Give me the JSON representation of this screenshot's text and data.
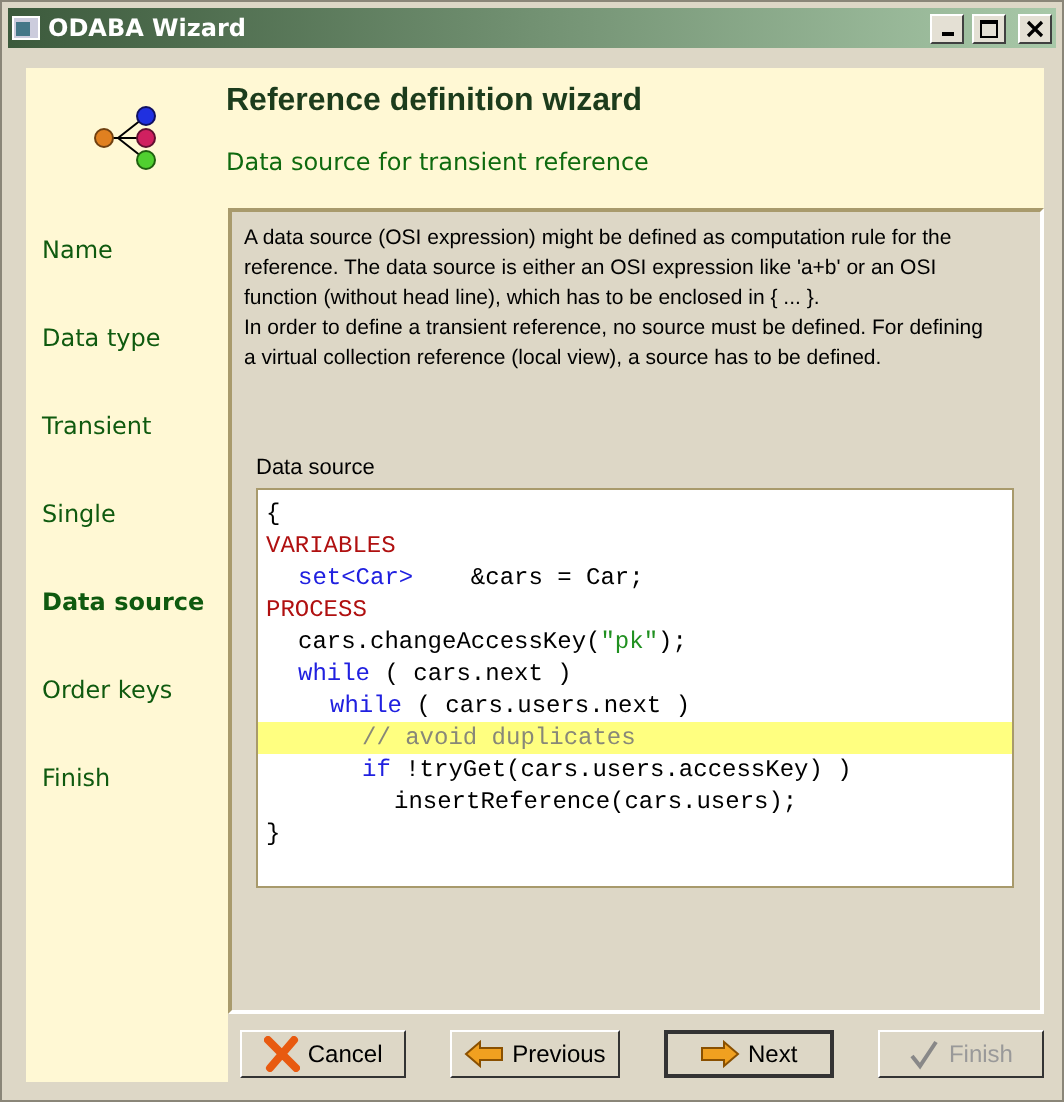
{
  "window": {
    "title": "ODABA Wizard"
  },
  "header": {
    "title": "Reference definition wizard",
    "subtitle": "Data source for transient reference"
  },
  "steps": [
    {
      "label": "Name",
      "selected": false
    },
    {
      "label": "Data type",
      "selected": false
    },
    {
      "label": "Transient",
      "selected": false
    },
    {
      "label": "Single",
      "selected": false
    },
    {
      "label": "Data source",
      "selected": true
    },
    {
      "label": "Order keys",
      "selected": false
    },
    {
      "label": "Finish",
      "selected": false
    }
  ],
  "description": [
    "A data source (OSI expression) might be defined as computation rule for the reference. The data source is either an OSI expression like 'a+b' or an OSI function (without head line), which has to be enclosed in { ... }.",
    "In order to define a transient reference, no source must be defined. For defining a virtual collection reference (local view), a source has to be defined."
  ],
  "editor": {
    "label": "Data source",
    "lines": [
      {
        "highlighted": false,
        "segments": [
          {
            "kind": "plain",
            "text": "{"
          }
        ]
      },
      {
        "highlighted": false,
        "segments": [
          {
            "kind": "keyword",
            "text": "VARIABLES"
          }
        ],
        "children": [
          {
            "highlighted": false,
            "segments": [
              {
                "kind": "type",
                "text": "set<Car>"
              },
              {
                "kind": "plain",
                "text": "    &cars = Car;"
              }
            ]
          }
        ]
      },
      {
        "highlighted": false,
        "segments": [
          {
            "kind": "keyword",
            "text": "PROCESS"
          }
        ],
        "children": [
          {
            "highlighted": false,
            "segments": [
              {
                "kind": "plain",
                "text": "cars.changeAccessKey("
              },
              {
                "kind": "string",
                "text": "\"pk\""
              },
              {
                "kind": "plain",
                "text": ");"
              }
            ]
          },
          {
            "highlighted": false,
            "segments": [
              {
                "kind": "type",
                "text": "while"
              },
              {
                "kind": "plain",
                "text": " ( cars.next )"
              }
            ],
            "children": [
              {
                "highlighted": false,
                "segments": [
                  {
                    "kind": "type",
                    "text": "while"
                  },
                  {
                    "kind": "plain",
                    "text": " ( cars.users.next )"
                  }
                ],
                "children": [
                  {
                    "highlighted": true,
                    "segments": [
                      {
                        "kind": "comment",
                        "text": "// avoid duplicates"
                      }
                    ]
                  },
                  {
                    "highlighted": false,
                    "segments": [
                      {
                        "kind": "type",
                        "text": "if"
                      },
                      {
                        "kind": "plain",
                        "text": " !tryGet(cars.users.accessKey) )"
                      }
                    ],
                    "children": [
                      {
                        "highlighted": false,
                        "segments": [
                          {
                            "kind": "plain",
                            "text": "insertReference(cars.users);"
                          }
                        ]
                      }
                    ]
                  }
                ]
              }
            ]
          }
        ]
      },
      {
        "highlighted": false,
        "segments": [
          {
            "kind": "plain",
            "text": "}"
          }
        ]
      }
    ]
  },
  "buttons": [
    {
      "kind": "cancel",
      "label": "Cancel",
      "default": false,
      "disabled": false
    },
    {
      "kind": "previous",
      "label": "Previous",
      "default": false,
      "disabled": false
    },
    {
      "kind": "next",
      "label": "Next",
      "default": true,
      "disabled": false
    },
    {
      "kind": "finish",
      "label": "Finish",
      "default": false,
      "disabled": true
    }
  ]
}
